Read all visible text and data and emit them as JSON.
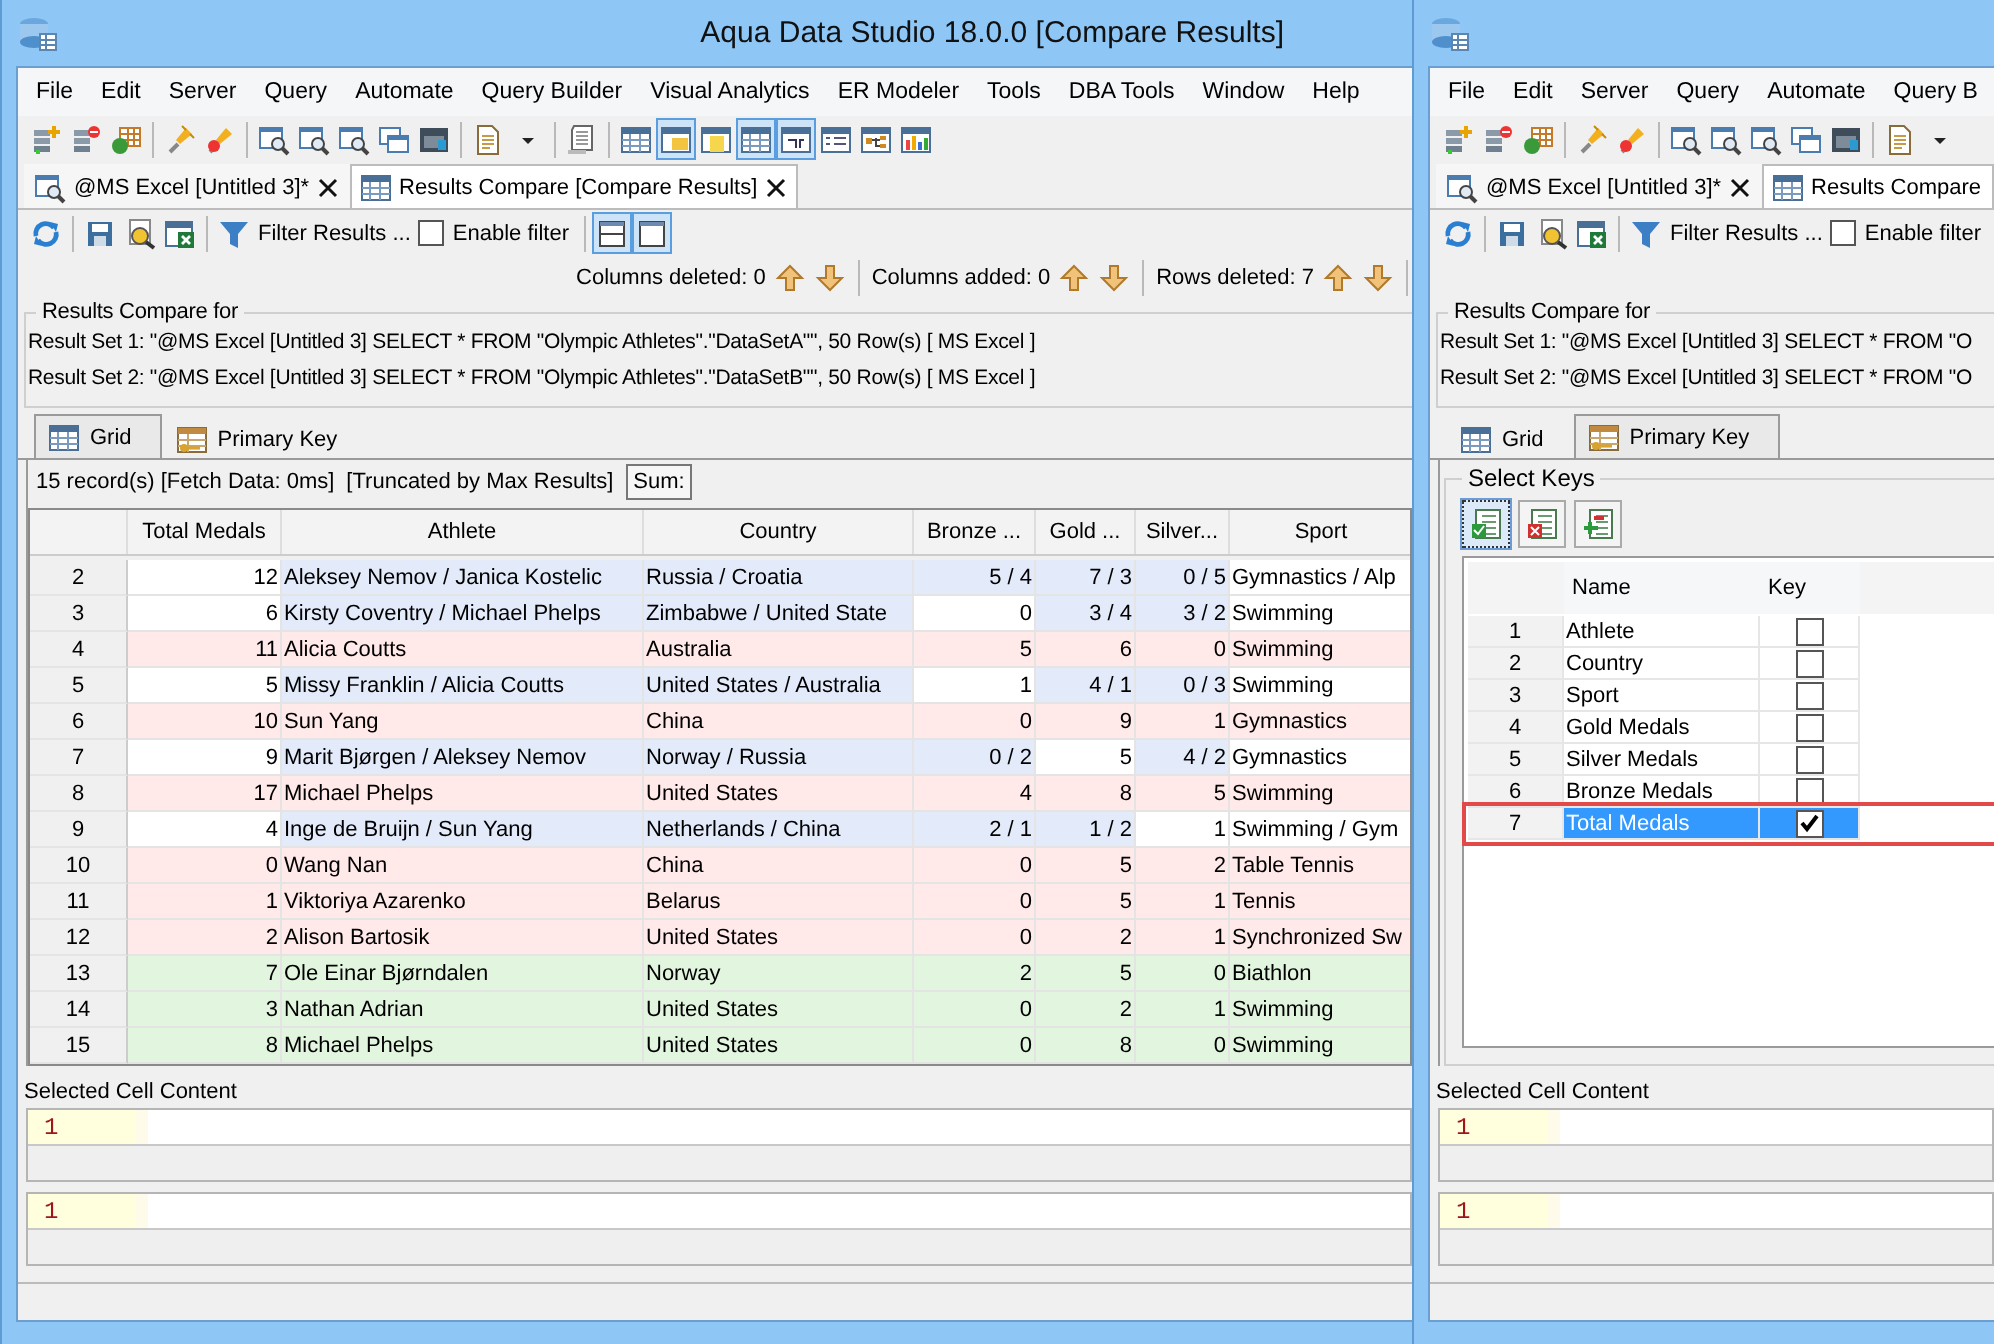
{
  "windows": [
    {
      "title": "Aqua Data Studio 18.0.0 [Compare Results]",
      "menu": [
        "File",
        "Edit",
        "Server",
        "Query",
        "Automate",
        "Query Builder",
        "Visual Analytics",
        "ER Modeler",
        "Tools",
        "DBA Tools",
        "Window",
        "Help"
      ],
      "toolbar": [
        {
          "kind": "server-add",
          "on": false
        },
        {
          "kind": "server-remove",
          "on": false
        },
        {
          "kind": "table-green",
          "on": false
        },
        {
          "kind": "sep"
        },
        {
          "kind": "plug",
          "on": false
        },
        {
          "kind": "plug-off",
          "on": false
        },
        {
          "kind": "sep"
        },
        {
          "kind": "query",
          "on": false
        },
        {
          "kind": "query",
          "on": false
        },
        {
          "kind": "query",
          "on": false
        },
        {
          "kind": "windows",
          "on": false
        },
        {
          "kind": "dark-window",
          "on": false
        },
        {
          "kind": "sep"
        },
        {
          "kind": "page",
          "on": false
        },
        {
          "kind": "caret",
          "on": false
        },
        {
          "kind": "sep"
        },
        {
          "kind": "script",
          "on": false
        },
        {
          "kind": "sep"
        },
        {
          "kind": "grid",
          "on": false
        },
        {
          "kind": "panel",
          "on": true
        },
        {
          "kind": "note",
          "on": false
        },
        {
          "kind": "grid",
          "on": true
        },
        {
          "kind": "pivot",
          "on": true
        },
        {
          "kind": "list",
          "on": false
        },
        {
          "kind": "tree",
          "on": false
        },
        {
          "kind": "chart",
          "on": false
        }
      ],
      "doc_tabs": [
        {
          "label": "@MS Excel [Untitled 3]*",
          "kind": "query",
          "selected": false,
          "closable": true
        },
        {
          "label": "Results Compare [Compare Results]",
          "kind": "compare",
          "selected": true,
          "closable": true
        }
      ],
      "action_bar": [
        {
          "kind": "refresh",
          "on": false
        },
        {
          "kind": "sep"
        },
        {
          "kind": "save",
          "on": false
        },
        {
          "kind": "preview",
          "on": false
        },
        {
          "kind": "excel",
          "on": false
        },
        {
          "kind": "sep"
        },
        {
          "kind": "filter",
          "label": "Filter Results ...",
          "on": false
        },
        {
          "kind": "checkbox",
          "label": "Enable filter",
          "checked": false
        },
        {
          "kind": "sep"
        },
        {
          "kind": "split",
          "on": true
        },
        {
          "kind": "single",
          "on": true
        }
      ],
      "counters": [
        {
          "label": "Columns deleted: 0"
        },
        {
          "label": "Columns added: 0"
        },
        {
          "label": "Rows deleted: 7"
        }
      ],
      "compare_group": {
        "title": "Results Compare for",
        "lines": [
          "Result Set 1: \"@MS Excel [Untitled 3] SELECT * FROM \"Olympic Athletes\".\"DataSetA\"\", 50 Row(s)  [ MS Excel ]",
          "Result Set 2: \"@MS Excel [Untitled 3] SELECT * FROM \"Olympic Athletes\".\"DataSetB\"\", 50 Row(s)  [ MS Excel ]"
        ]
      },
      "view_tabs": [
        {
          "label": "Grid",
          "kind": "grid",
          "selected": true
        },
        {
          "label": "Primary Key",
          "kind": "keys",
          "selected": false
        }
      ],
      "grid": {
        "info": [
          "15 record(s) [Fetch Data: 0ms]",
          "[Truncated by Max Results]"
        ],
        "sum_label": "Sum:",
        "columns": [
          "Total Medals",
          "Athlete",
          "Country",
          "Bronze ...",
          "Gold ...",
          "Silver...",
          "Sport"
        ],
        "rows": [
          {
            "num": "2",
            "kind": "changed",
            "cells": [
              "12",
              "Aleksey Nemov / Janica Kostelic",
              "Russia / Croatia",
              "5 / 4",
              "7 / 3",
              "0 / 5",
              "Gymnastics / Alp"
            ],
            "changed": [
              false,
              true,
              true,
              true,
              true,
              true,
              false
            ]
          },
          {
            "num": "3",
            "kind": "changed",
            "cells": [
              "6",
              "Kirsty Coventry / Michael Phelps",
              "Zimbabwe / United State",
              "0",
              "3 / 4",
              "3 / 2",
              "Swimming"
            ],
            "changed": [
              false,
              true,
              true,
              false,
              true,
              true,
              false
            ]
          },
          {
            "num": "4",
            "kind": "deleted",
            "cells": [
              "11",
              "Alicia Coutts",
              "Australia",
              "5",
              "6",
              "0",
              "Swimming"
            ]
          },
          {
            "num": "5",
            "kind": "changed",
            "cells": [
              "5",
              "Missy Franklin / Alicia Coutts",
              "United States / Australia",
              "1",
              "4 / 1",
              "0 / 3",
              "Swimming"
            ],
            "changed": [
              false,
              true,
              true,
              false,
              true,
              true,
              false
            ]
          },
          {
            "num": "6",
            "kind": "deleted",
            "cells": [
              "10",
              "Sun Yang",
              "China",
              "0",
              "9",
              "1",
              "Gymnastics"
            ]
          },
          {
            "num": "7",
            "kind": "changed",
            "cells": [
              "9",
              "Marit Bjørgen / Aleksey Nemov",
              "Norway / Russia",
              "0 / 2",
              "5",
              "4 / 2",
              "Gymnastics"
            ],
            "changed": [
              false,
              true,
              true,
              true,
              false,
              true,
              false
            ]
          },
          {
            "num": "8",
            "kind": "deleted",
            "cells": [
              "17",
              "Michael Phelps",
              "United States",
              "4",
              "8",
              "5",
              "Swimming"
            ]
          },
          {
            "num": "9",
            "kind": "changed",
            "cells": [
              "4",
              "Inge de Bruijn / Sun Yang",
              "Netherlands / China",
              "2 / 1",
              "1 / 2",
              "1",
              "Swimming / Gym"
            ],
            "changed": [
              false,
              true,
              true,
              true,
              true,
              false,
              false
            ]
          },
          {
            "num": "10",
            "kind": "deleted",
            "cells": [
              "0",
              "Wang Nan",
              "China",
              "0",
              "5",
              "2",
              "Table Tennis"
            ]
          },
          {
            "num": "11",
            "kind": "deleted",
            "cells": [
              "1",
              "Viktoriya Azarenko",
              "Belarus",
              "0",
              "5",
              "1",
              "Tennis"
            ]
          },
          {
            "num": "12",
            "kind": "deleted",
            "cells": [
              "2",
              "Alison Bartosik",
              "United States",
              "0",
              "2",
              "1",
              "Synchronized Sw"
            ]
          },
          {
            "num": "13",
            "kind": "added",
            "cells": [
              "7",
              "Ole Einar Bjørndalen",
              "Norway",
              "2",
              "5",
              "0",
              "Biathlon"
            ]
          },
          {
            "num": "14",
            "kind": "added",
            "cells": [
              "3",
              "Nathan Adrian",
              "United States",
              "0",
              "2",
              "1",
              "Swimming"
            ]
          },
          {
            "num": "15",
            "kind": "added",
            "cells": [
              "8",
              "Michael Phelps",
              "United States",
              "0",
              "8",
              "0",
              "Swimming"
            ]
          }
        ]
      },
      "selected_cell": {
        "title": "Selected Cell Content",
        "editors": [
          {
            "line": "1"
          },
          {
            "line": "1"
          }
        ]
      }
    },
    {
      "menu": [
        "File",
        "Edit",
        "Server",
        "Query",
        "Automate",
        "Query B"
      ],
      "toolbar": [
        {
          "kind": "server-add",
          "on": false
        },
        {
          "kind": "server-remove",
          "on": false
        },
        {
          "kind": "table-green",
          "on": false
        },
        {
          "kind": "sep"
        },
        {
          "kind": "plug",
          "on": false
        },
        {
          "kind": "plug-off",
          "on": false
        },
        {
          "kind": "sep"
        },
        {
          "kind": "query",
          "on": false
        },
        {
          "kind": "query",
          "on": false
        },
        {
          "kind": "query",
          "on": false
        },
        {
          "kind": "windows",
          "on": false
        },
        {
          "kind": "dark-window",
          "on": false
        },
        {
          "kind": "sep"
        },
        {
          "kind": "page",
          "on": false
        },
        {
          "kind": "caret",
          "on": false
        }
      ],
      "doc_tabs": [
        {
          "label": "@MS Excel [Untitled 3]*",
          "kind": "query",
          "selected": false,
          "closable": true
        },
        {
          "label": "Results Compare",
          "kind": "compare",
          "selected": true,
          "closable": false
        }
      ],
      "action_bar": [
        {
          "kind": "refresh",
          "on": false
        },
        {
          "kind": "sep"
        },
        {
          "kind": "save",
          "on": false
        },
        {
          "kind": "preview",
          "on": false
        },
        {
          "kind": "excel",
          "on": false
        },
        {
          "kind": "sep"
        },
        {
          "kind": "filter",
          "label": "Filter Results ...",
          "on": false
        },
        {
          "kind": "checkbox",
          "label": "Enable filter",
          "checked": false
        }
      ],
      "compare_group": {
        "title": "Results Compare for",
        "lines": [
          "Result Set 1: \"@MS Excel [Untitled 3] SELECT * FROM \"O",
          "Result Set 2: \"@MS Excel [Untitled 3] SELECT * FROM \"O"
        ]
      },
      "view_tabs": [
        {
          "label": "Grid",
          "kind": "grid",
          "selected": false
        },
        {
          "label": "Primary Key",
          "kind": "keys",
          "selected": true
        }
      ],
      "keys": {
        "title": "Select Keys",
        "tools": [
          {
            "kind": "check-all",
            "on": true
          },
          {
            "kind": "clear",
            "on": false
          },
          {
            "kind": "insert",
            "on": false
          }
        ],
        "columns": [
          "Name",
          "Key"
        ],
        "rows": [
          {
            "num": "1",
            "name": "Athlete",
            "checked": false,
            "selected": false,
            "outlined": false
          },
          {
            "num": "2",
            "name": "Country",
            "checked": false,
            "selected": false,
            "outlined": false
          },
          {
            "num": "3",
            "name": "Sport",
            "checked": false,
            "selected": false,
            "outlined": false
          },
          {
            "num": "4",
            "name": "Gold Medals",
            "checked": false,
            "selected": false,
            "outlined": false
          },
          {
            "num": "5",
            "name": "Silver Medals",
            "checked": false,
            "selected": false,
            "outlined": false
          },
          {
            "num": "6",
            "name": "Bronze Medals",
            "checked": false,
            "selected": false,
            "outlined": false
          },
          {
            "num": "7",
            "name": "Total Medals",
            "checked": true,
            "selected": true,
            "outlined": true
          }
        ]
      },
      "selected_cell": {
        "title": "Selected Cell Content",
        "editors": [
          {
            "line": "1"
          },
          {
            "line": "1"
          }
        ]
      }
    }
  ]
}
